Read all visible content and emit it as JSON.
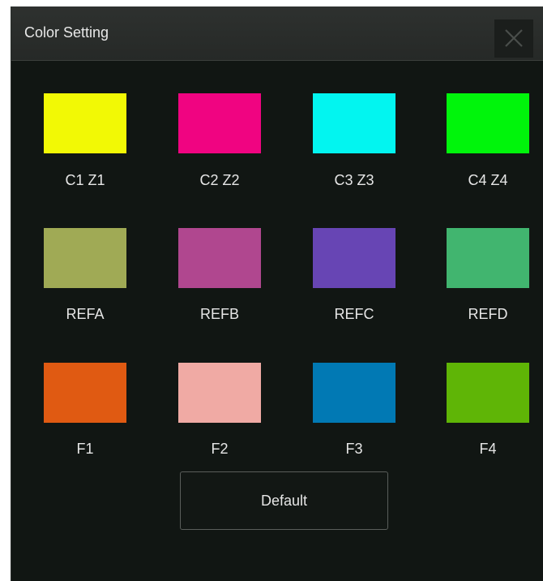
{
  "dialog": {
    "title": "Color Setting",
    "default_label": "Default"
  },
  "rows": [
    [
      {
        "label": "C1 Z1",
        "color": "#f2f905"
      },
      {
        "label": "C2 Z2",
        "color": "#f00481"
      },
      {
        "label": "C3 Z3",
        "color": "#02f5f0"
      },
      {
        "label": "C4 Z4",
        "color": "#00f50b"
      }
    ],
    [
      {
        "label": "REFA",
        "color": "#a0aa55"
      },
      {
        "label": "REFB",
        "color": "#b0478f"
      },
      {
        "label": "REFC",
        "color": "#6745b4"
      },
      {
        "label": "REFD",
        "color": "#41b56f"
      }
    ],
    [
      {
        "label": "F1",
        "color": "#e05a12"
      },
      {
        "label": "F2",
        "color": "#f0aaa4"
      },
      {
        "label": "F3",
        "color": "#0179b4"
      },
      {
        "label": "F4",
        "color": "#5fb506"
      }
    ]
  ]
}
